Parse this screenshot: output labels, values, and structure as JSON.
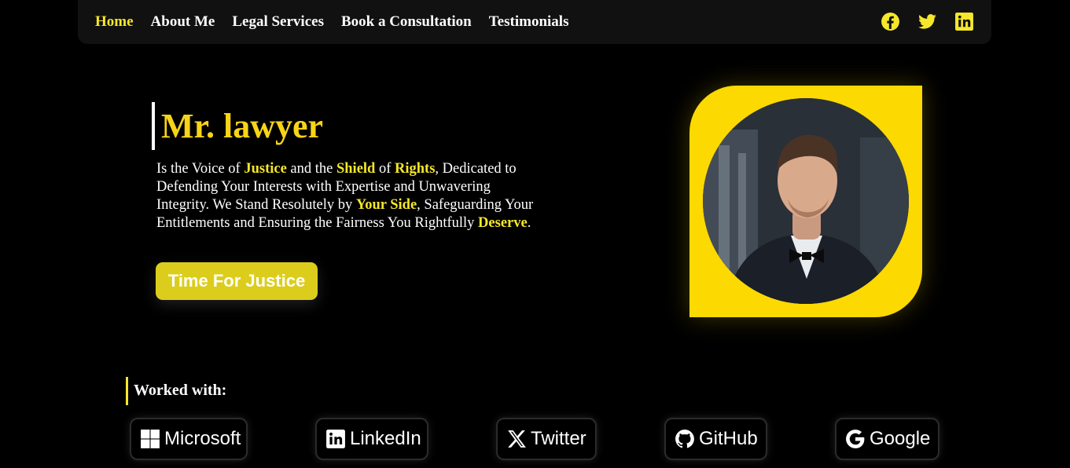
{
  "nav": {
    "links": [
      {
        "label": "Home",
        "active": true
      },
      {
        "label": "About Me",
        "active": false
      },
      {
        "label": "Legal Services",
        "active": false
      },
      {
        "label": "Book a Consultation",
        "active": false
      },
      {
        "label": "Testimonials",
        "active": false
      }
    ],
    "social_icons": [
      "facebook-icon",
      "twitter-icon",
      "linkedin-icon"
    ]
  },
  "hero": {
    "title": "Mr. lawyer",
    "desc": {
      "p1": "Is the Voice of ",
      "h1": "Justice",
      "p2": " and the ",
      "h2": "Shield",
      "p3": " of ",
      "h3": "Rights",
      "p4": ", Dedicated to Defending Your Interests with Expertise and Unwavering Integrity. We Stand Resolutely by ",
      "h4": "Your Side",
      "p5": ", Safeguarding Your Entitlements and Ensuring the Fairness You Rightfully ",
      "h5": "Deserve",
      "p6": "."
    },
    "cta_label": "Time For Justice"
  },
  "worked": {
    "title": "Worked with:",
    "brands": [
      {
        "label": "Microsoft",
        "icon": "microsoft-icon"
      },
      {
        "label": "LinkedIn",
        "icon": "linkedin-icon"
      },
      {
        "label": "Twitter",
        "icon": "x-icon"
      },
      {
        "label": "GitHub",
        "icon": "github-icon"
      },
      {
        "label": "Google",
        "icon": "google-icon"
      }
    ]
  },
  "colors": {
    "accent": "#f5e72a",
    "title_yellow": "#f7d417",
    "frame_yellow": "#fcd901",
    "button": "#dccd1c",
    "background": "#000000",
    "navbar": "#111111"
  }
}
